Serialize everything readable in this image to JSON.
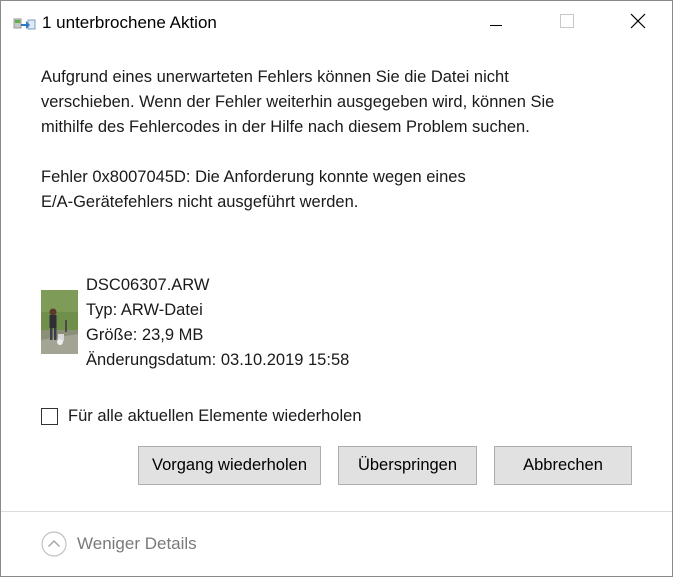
{
  "window": {
    "title": "1 unterbrochene Aktion"
  },
  "message": {
    "line1": "Aufgrund eines unerwarteten Fehlers können Sie die Datei nicht",
    "line2": "verschieben. Wenn der Fehler weiterhin ausgegeben wird, können Sie",
    "line3": "mithilfe des Fehlercodes in der Hilfe nach diesem Problem suchen."
  },
  "error": {
    "line1": "Fehler 0x8007045D: Die Anforderung konnte wegen eines",
    "line2": "E/A-Gerätefehlers nicht ausgeführt werden."
  },
  "file": {
    "name": "DSC06307.ARW",
    "type": "Typ: ARW-Datei",
    "size": "Größe: 23,9 MB",
    "modified": "Änderungsdatum: 03.10.2019 15:58"
  },
  "checkbox": {
    "label": "Für alle aktuellen Elemente wiederholen",
    "checked": false
  },
  "buttons": {
    "retry": "Vorgang wiederholen",
    "skip": "Überspringen",
    "cancel": "Abbrechen"
  },
  "footer": {
    "details_label": "Weniger Details"
  }
}
